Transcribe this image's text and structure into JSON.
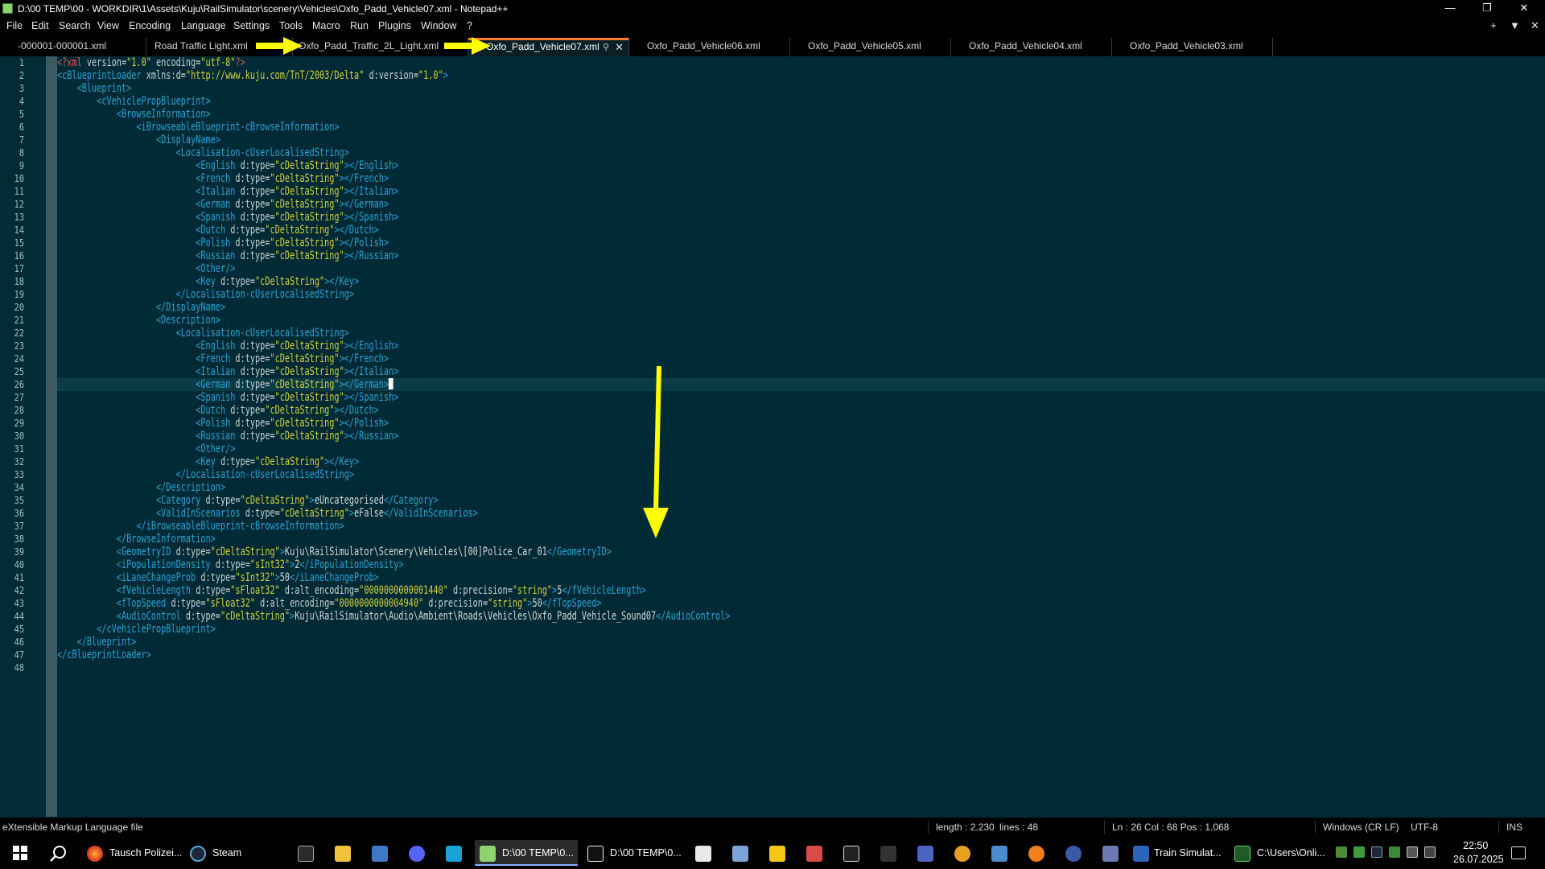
{
  "window": {
    "title": "D:\\00 TEMP\\00 - WORKDIR\\1\\Assets\\Kuju\\RailSimulator\\scenery\\Vehicles\\Oxfo_Padd_Vehicle07.xml - Notepad++"
  },
  "menu": [
    "File",
    "Edit",
    "Search",
    "View",
    "Encoding",
    "Language",
    "Settings",
    "Tools",
    "Macro",
    "Run",
    "Plugins",
    "Window",
    "?"
  ],
  "menu_right": [
    "+",
    "▼",
    "✕"
  ],
  "tabs": [
    "-000001-000001.xml",
    "Road Traffic Light.xml",
    "Oxfo_Padd_Traffic_2L_Light.xml",
    "Oxfo_Padd_Vehicle07.xml",
    "Oxfo_Padd_Vehicle06.xml",
    "Oxfo_Padd_Vehicle05.xml",
    "Oxfo_Padd_Vehicle04.xml",
    "Oxfo_Padd_Vehicle03.xml"
  ],
  "active_tab": 3,
  "code_lines": [
    "<?xml version=\"1.0\" encoding=\"utf-8\"?>",
    "<cBlueprintLoader xmlns:d=\"http://www.kuju.com/TnT/2003/Delta\" d:version=\"1.0\">",
    "    <Blueprint>",
    "        <cVehiclePropBlueprint>",
    "            <BrowseInformation>",
    "                <iBrowseableBlueprint-cBrowseInformation>",
    "                    <DisplayName>",
    "                        <Localisation-cUserLocalisedString>",
    "                            <English d:type=\"cDeltaString\"></English>",
    "                            <French d:type=\"cDeltaString\"></French>",
    "                            <Italian d:type=\"cDeltaString\"></Italian>",
    "                            <German d:type=\"cDeltaString\"></German>",
    "                            <Spanish d:type=\"cDeltaString\"></Spanish>",
    "                            <Dutch d:type=\"cDeltaString\"></Dutch>",
    "                            <Polish d:type=\"cDeltaString\"></Polish>",
    "                            <Russian d:type=\"cDeltaString\"></Russian>",
    "                            <Other/>",
    "                            <Key d:type=\"cDeltaString\"></Key>",
    "                        </Localisation-cUserLocalisedString>",
    "                    </DisplayName>",
    "                    <Description>",
    "                        <Localisation-cUserLocalisedString>",
    "                            <English d:type=\"cDeltaString\"></English>",
    "                            <French d:type=\"cDeltaString\"></French>",
    "                            <Italian d:type=\"cDeltaString\"></Italian>",
    "                            <German d:type=\"cDeltaString\"></German>",
    "                            <Spanish d:type=\"cDeltaString\"></Spanish>",
    "                            <Dutch d:type=\"cDeltaString\"></Dutch>",
    "                            <Polish d:type=\"cDeltaString\"></Polish>",
    "                            <Russian d:type=\"cDeltaString\"></Russian>",
    "                            <Other/>",
    "                            <Key d:type=\"cDeltaString\"></Key>",
    "                        </Localisation-cUserLocalisedString>",
    "                    </Description>",
    "                    <Category d:type=\"cDeltaString\">eUncategorised</Category>",
    "                    <ValidInScenarios d:type=\"cDeltaString\">eFalse</ValidInScenarios>",
    "                </iBrowseableBlueprint-cBrowseInformation>",
    "            </BrowseInformation>",
    "            <GeometryID d:type=\"cDeltaString\">Kuju\\RailSimulator\\Scenery\\Vehicles\\[00]Police_Car_01</GeometryID>",
    "            <iPopulationDensity d:type=\"sInt32\">2</iPopulationDensity>",
    "            <iLaneChangeProb d:type=\"sInt32\">50</iLaneChangeProb>",
    "            <fVehicleLength d:type=\"sFloat32\" d:alt_encoding=\"0000000000001440\" d:precision=\"string\">5</fVehicleLength>",
    "            <fTopSpeed d:type=\"sFloat32\" d:alt_encoding=\"0000000000004940\" d:precision=\"string\">50</fTopSpeed>",
    "            <AudioControl d:type=\"cDeltaString\">Kuju\\RailSimulator\\Audio\\Ambient\\Roads\\Vehicles\\Oxfo_Padd_Vehicle_Sound07</AudioControl>",
    "        </cVehiclePropBlueprint>",
    "    </Blueprint>",
    "</cBlueprintLoader>",
    ""
  ],
  "cursor_line": 26,
  "status": {
    "filetype": "eXtensible Markup Language file",
    "length": "length : 2.230",
    "lines": "lines : 48",
    "position": "Ln : 26    Col : 68    Pos : 1.068",
    "eol": "Windows (CR LF)",
    "encoding": "UTF-8",
    "mode": "INS"
  },
  "taskbar": {
    "items": [
      "Tausch Polizei...",
      "Steam",
      "D:\\00 TEMP\\0...",
      "D:\\00 TEMP\\0...",
      "Train Simulat...",
      "C:\\Users\\Onli..."
    ],
    "time": "22:50",
    "date": "26.07.2025"
  },
  "colors": {
    "background": "#002b36",
    "tag": "#2aa1d3",
    "attr_value": "#d6cf3a",
    "active_tab_accent": "#ff7a2a",
    "annotation_arrow": "#ffff00"
  },
  "annotations": {
    "arrows": [
      "tab-arrow",
      "tab-arrow",
      "down-arrow"
    ]
  }
}
